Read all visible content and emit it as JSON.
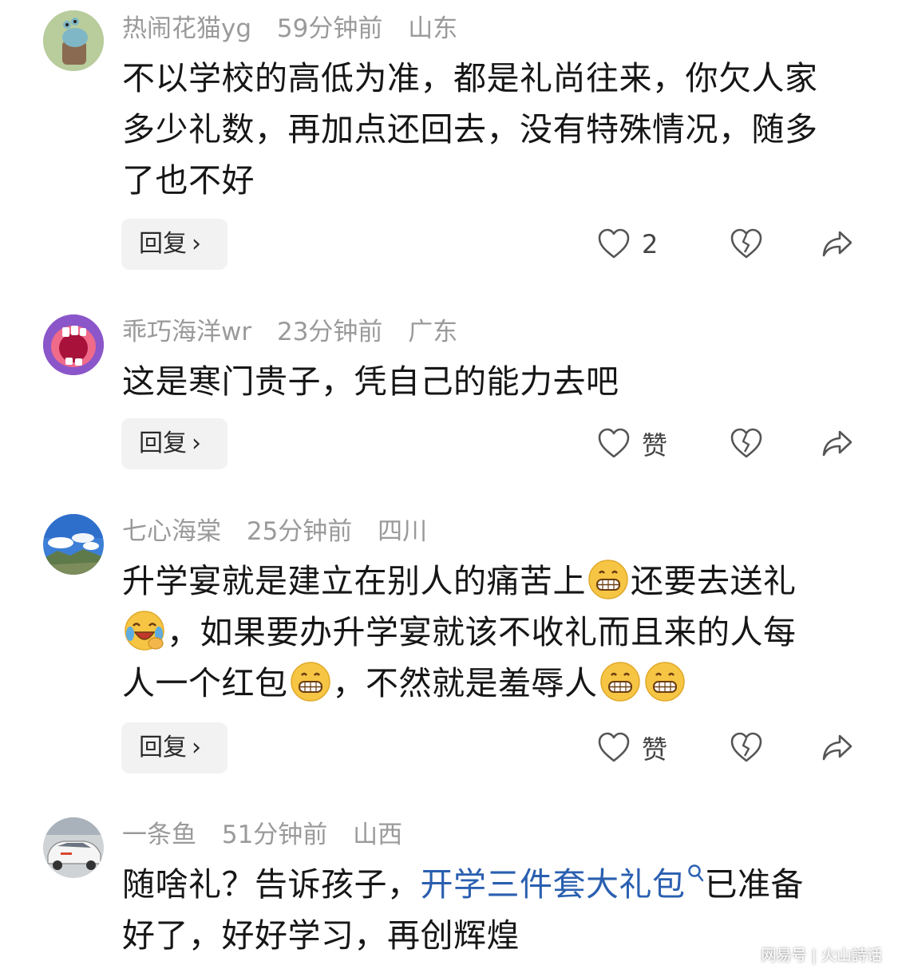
{
  "comments": [
    {
      "username": "热闹花猫yg",
      "time": "59分钟前",
      "location": "山东",
      "avatar": "cartoon-snail-avatar",
      "text_lines": [
        "不以学校的高低为准，都是礼尚往来，你欠人家",
        "多少礼数，再加点还回去，没有特殊情况，随多",
        "了也不好"
      ],
      "reply_label": "回复",
      "like_label": "2"
    },
    {
      "username": "乖巧海洋wr",
      "time": "23分钟前",
      "location": "广东",
      "avatar": "cartoon-mouth-avatar",
      "text_lines": [
        "这是寒门贵子，凭自己的能力去吧"
      ],
      "reply_label": "回复",
      "like_label": "赞"
    },
    {
      "username": "七心海棠",
      "time": "25分钟前",
      "location": "四川",
      "avatar": "sky-landscape-avatar",
      "text_parts": {
        "l1a": "升学宴就是建立在别人的痛苦上",
        "l1b": "还要去送礼",
        "l2": "，如果要办升学宴就该不收礼而且来的人每",
        "l3a": "人一个红包",
        "l3b": "，不然就是羞辱人"
      },
      "reply_label": "回复",
      "like_label": "赞"
    },
    {
      "username": "一条鱼",
      "time": "51分钟前",
      "location": "山西",
      "avatar": "white-car-avatar",
      "text_parts": {
        "l1a": "随啥礼？告诉孩子，",
        "l1link": "开学三件套大礼包",
        "l1b": "已准备",
        "l2": "好了，好好学习，再创辉煌"
      }
    }
  ],
  "watermark": "网易号 | 火山詩话",
  "colors": {
    "link": "#2a5fb0",
    "meta": "#9a9a9a",
    "text": "#161616",
    "reply_bg": "#f2f2f2"
  }
}
